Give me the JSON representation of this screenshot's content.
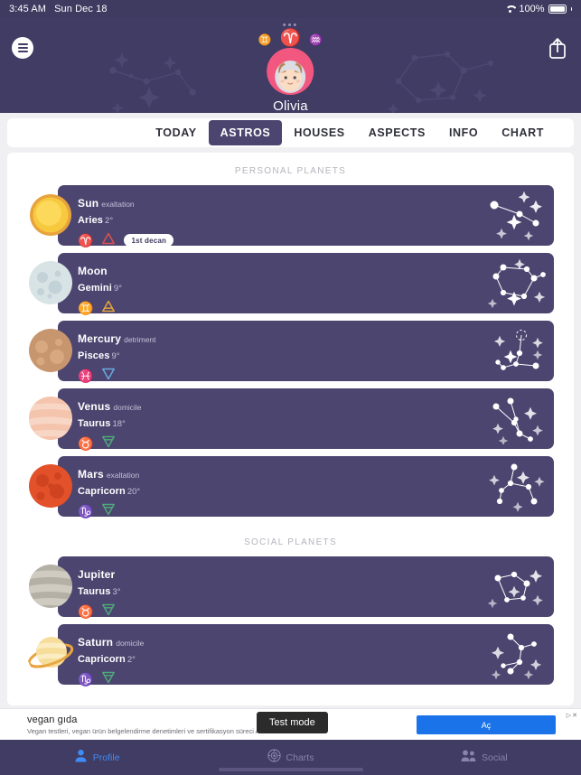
{
  "statusbar": {
    "time": "3:45 AM",
    "date": "Sun Dec 18",
    "battery": "100%",
    "wifi_icon": "wifi-icon",
    "battery_icon": "battery-icon"
  },
  "header": {
    "dots": "•••",
    "menu_icon": "hamburger-menu-icon",
    "share_icon": "share-icon",
    "username": "Olivia",
    "glyph_left": "♊",
    "glyph_center": "♈",
    "glyph_right": "♒",
    "avatar_name": "aries-avatar"
  },
  "tabs": [
    {
      "label": "TODAY",
      "active": false
    },
    {
      "label": "ASTROS",
      "active": true
    },
    {
      "label": "HOUSES",
      "active": false
    },
    {
      "label": "ASPECTS",
      "active": false
    },
    {
      "label": "INFO",
      "active": false
    },
    {
      "label": "CHART",
      "active": false
    }
  ],
  "sections": [
    {
      "title": "PERSONAL PLANETS",
      "planets": [
        {
          "name": "Sun",
          "dignity": "exaltation",
          "sign": "Aries",
          "degree": "2°",
          "glyph": "♈",
          "element": "fire",
          "decan": "1st decan"
        },
        {
          "name": "Moon",
          "dignity": "",
          "sign": "Gemini",
          "degree": "9°",
          "glyph": "♊",
          "element": "air",
          "decan": ""
        },
        {
          "name": "Mercury",
          "dignity": "detriment",
          "sign": "Pisces",
          "degree": "9°",
          "glyph": "♓",
          "element": "water",
          "decan": ""
        },
        {
          "name": "Venus",
          "dignity": "domicile",
          "sign": "Taurus",
          "degree": "18°",
          "glyph": "♉",
          "element": "earth",
          "decan": ""
        },
        {
          "name": "Mars",
          "dignity": "exaltation",
          "sign": "Capricorn",
          "degree": "20°",
          "glyph": "♑",
          "element": "earth",
          "decan": ""
        }
      ]
    },
    {
      "title": "SOCIAL PLANETS",
      "planets": [
        {
          "name": "Jupiter",
          "dignity": "",
          "sign": "Taurus",
          "degree": "3°",
          "glyph": "♉",
          "element": "earth",
          "decan": ""
        },
        {
          "name": "Saturn",
          "dignity": "domicile",
          "sign": "Capricorn",
          "degree": "2°",
          "glyph": "♑",
          "element": "earth",
          "decan": ""
        }
      ]
    }
  ],
  "ad": {
    "title": "vegan gıda",
    "subtitle": "Vegan testleri, vegan ürün belgelendirme denetimleri ve sertifikasyon süreci AS...",
    "button": "Aç",
    "close_label": "▷✕",
    "test_mode": "Test mode"
  },
  "bottomnav": [
    {
      "label": "Profile",
      "icon": "person-icon",
      "active": true
    },
    {
      "label": "Charts",
      "icon": "natal-chart-icon",
      "active": false
    },
    {
      "label": "Social",
      "icon": "people-icon",
      "active": false
    }
  ],
  "colors": {
    "header_bg": "#413c63",
    "card_bg": "#4b456f",
    "accent_blue": "#3f8cf7",
    "fire": "#e0504e",
    "air": "#e8a33d",
    "water": "#6aa9e0",
    "earth": "#4fa87a"
  }
}
